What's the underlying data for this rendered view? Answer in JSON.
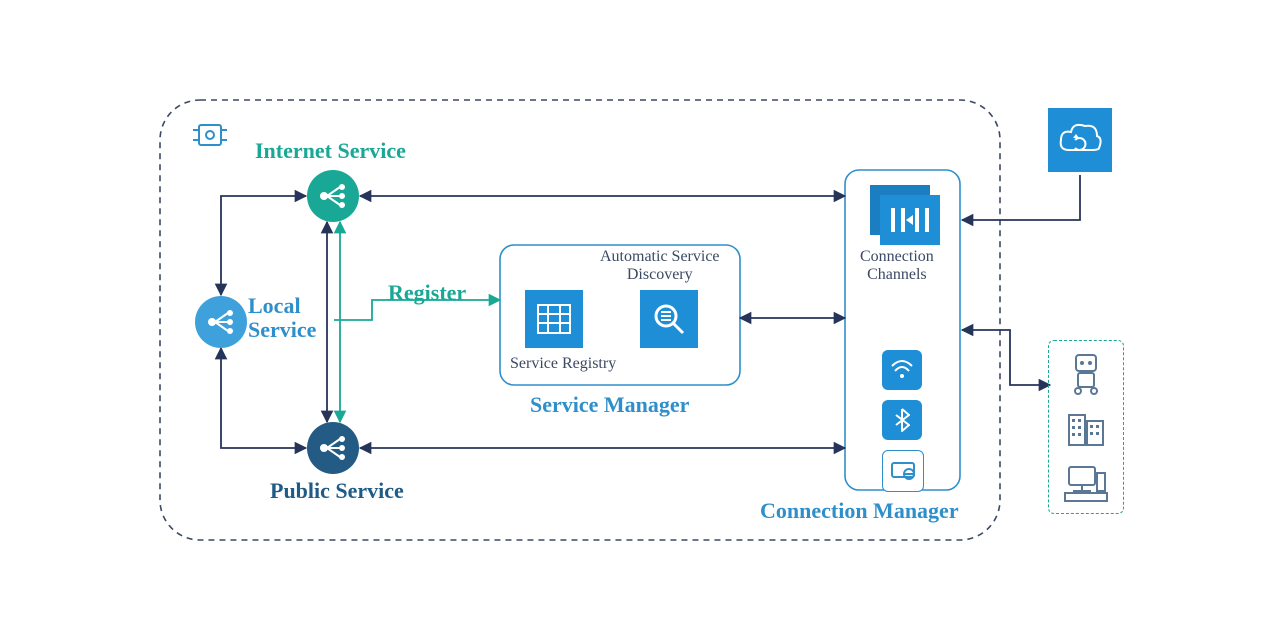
{
  "labels": {
    "internet_service": "Internet Service",
    "local_service": "Local\nService",
    "public_service": "Public Service",
    "register": "Register",
    "service_manager": "Service Manager",
    "service_registry": "Service Registry",
    "auto_discovery": "Automatic Service\nDiscovery",
    "connection_manager": "Connection Manager",
    "connection_channels": "Connection\nChannels"
  },
  "nodes": {
    "internet": {
      "type": "service-node",
      "color": "teal"
    },
    "local": {
      "type": "service-node",
      "color": "blue"
    },
    "public": {
      "type": "service-node",
      "color": "navy"
    }
  },
  "service_manager_box": {
    "items": [
      "service-registry-icon",
      "discovery-icon"
    ]
  },
  "connection_manager_box": {
    "header_icon": "channels-icon",
    "small_icons": [
      "wifi-icon",
      "bluetooth-icon",
      "lan-icon"
    ]
  },
  "external": {
    "cloud_icon": "cloud-sync-icon",
    "device_icons": [
      "robot-icon",
      "building-icon",
      "workstation-icon"
    ]
  },
  "edges": [
    {
      "from": "internet",
      "to": "connection_channels",
      "dir": "both"
    },
    {
      "from": "public",
      "to": "connection_channels",
      "dir": "both"
    },
    {
      "from": "internet",
      "to": "public",
      "dir": "both"
    },
    {
      "from": "local",
      "to": "internet",
      "dir": "both"
    },
    {
      "from": "local",
      "to": "public",
      "dir": "both"
    },
    {
      "from": "local",
      "to": "service_manager",
      "dir": "forward",
      "label": "Register"
    },
    {
      "from": "service_manager",
      "to": "connection_manager",
      "dir": "both"
    },
    {
      "from": "cloud",
      "to": "connection_manager",
      "dir": "forward"
    },
    {
      "from": "devices",
      "to": "connection_manager",
      "dir": "both"
    }
  ],
  "colors": {
    "teal": "#1aa896",
    "blue": "#3fa1db",
    "navy": "#245b85",
    "arrow": "#27345a",
    "box": "#2f8fcb"
  }
}
